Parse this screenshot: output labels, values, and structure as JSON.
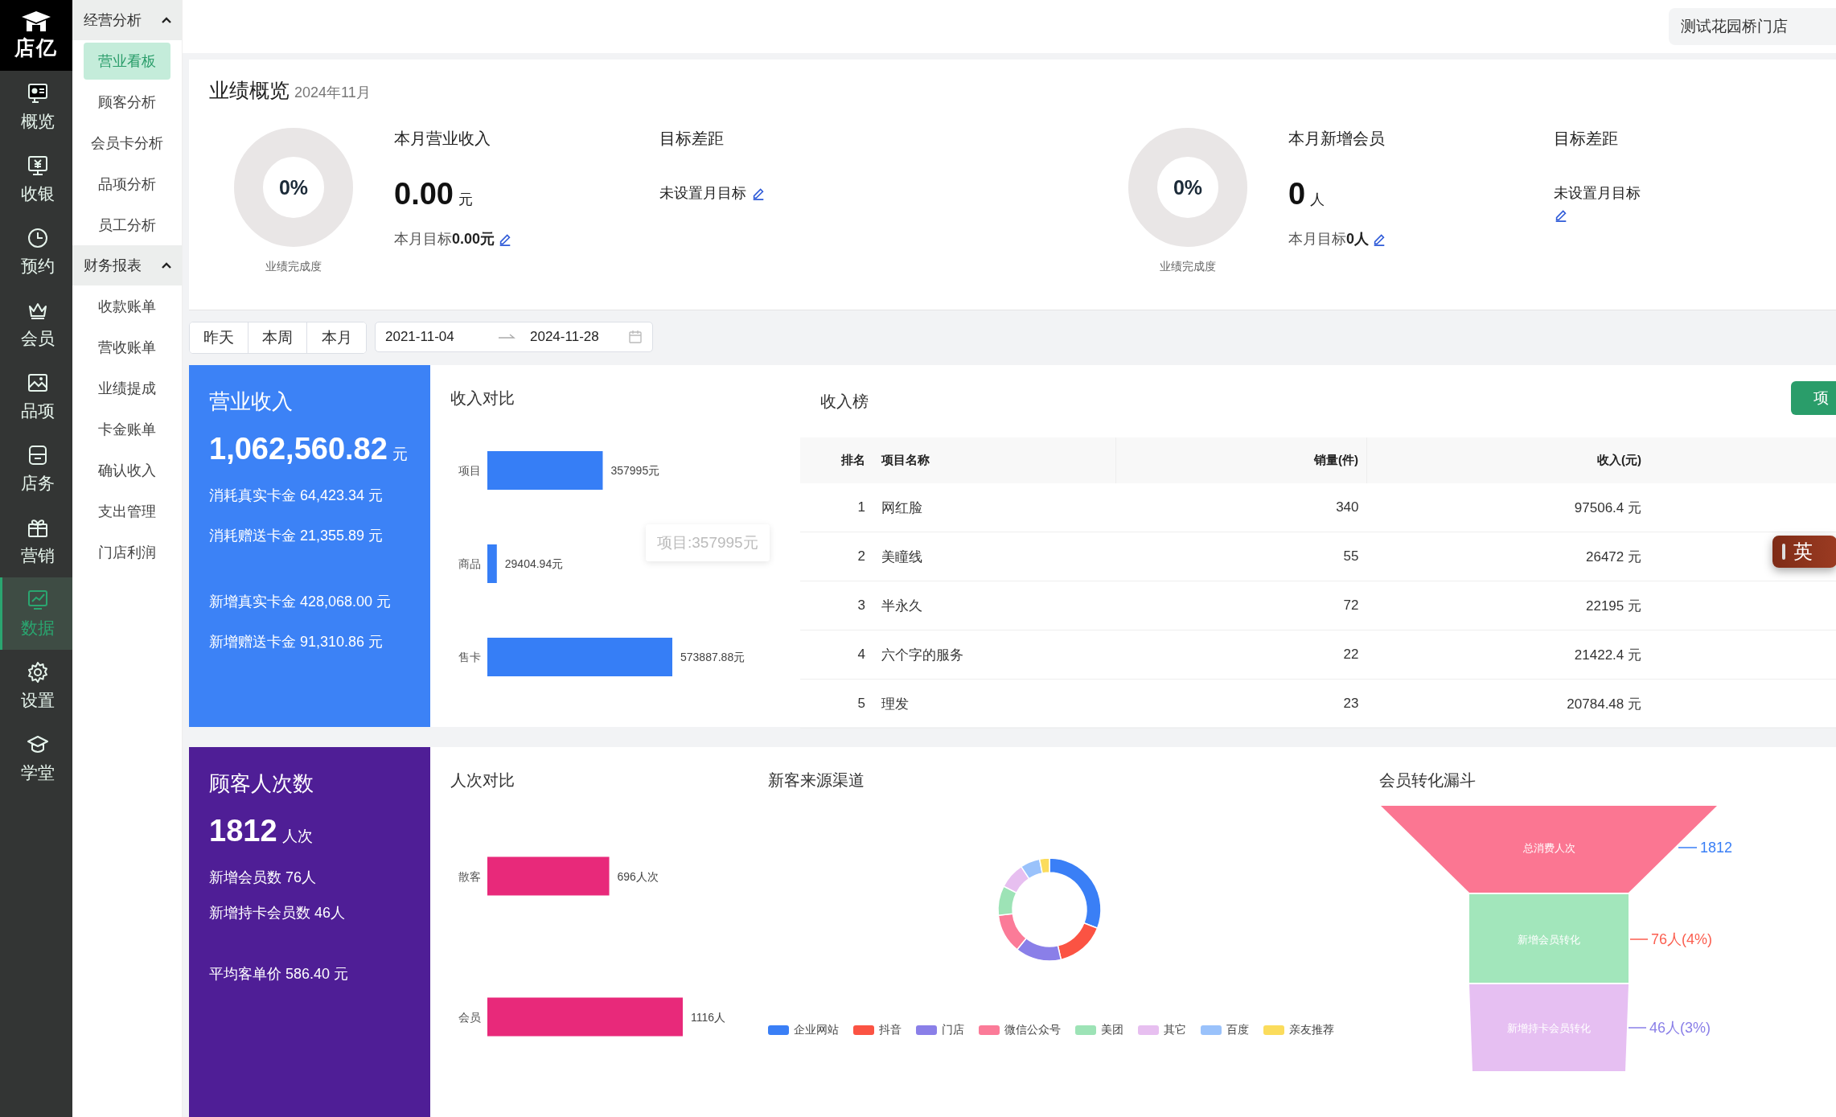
{
  "sidebar": {
    "logo": "店亿",
    "items": [
      {
        "label": "概览",
        "selected": false
      },
      {
        "label": "收银",
        "selected": false
      },
      {
        "label": "预约",
        "selected": false
      },
      {
        "label": "会员",
        "selected": false
      },
      {
        "label": "品项",
        "selected": false
      },
      {
        "label": "店务",
        "selected": false
      },
      {
        "label": "营销",
        "selected": false
      },
      {
        "label": "数据",
        "selected": true
      },
      {
        "label": "设置",
        "selected": false
      },
      {
        "label": "学堂",
        "selected": false
      }
    ]
  },
  "submenu": [
    {
      "title": "经营分析",
      "expanded": true,
      "items": [
        {
          "label": "营业看板",
          "selected": true
        },
        {
          "label": "顾客分析",
          "selected": false
        },
        {
          "label": "会员卡分析",
          "selected": false
        },
        {
          "label": "品项分析",
          "selected": false
        },
        {
          "label": "员工分析",
          "selected": false
        }
      ]
    },
    {
      "title": "财务报表",
      "expanded": true,
      "items": [
        {
          "label": "收款账单",
          "selected": false
        },
        {
          "label": "营收账单",
          "selected": false
        },
        {
          "label": "业绩提成",
          "selected": false
        },
        {
          "label": "卡金账单",
          "selected": false
        },
        {
          "label": "确认收入",
          "selected": false
        },
        {
          "label": "支出管理",
          "selected": false
        },
        {
          "label": "门店利润",
          "selected": false
        }
      ]
    }
  ],
  "header": {
    "store": "测试花园桥门店"
  },
  "overview": {
    "title": "业绩概览",
    "period": "2024年11月",
    "blocks": [
      {
        "gauge": "0%",
        "level": 0,
        "gauge_label": "业绩完成度",
        "metric_label": "本月营业收入",
        "value": "0.00",
        "unit": "元",
        "target_prefix": "本月目标",
        "target_value": "0.00元",
        "gap_label": "目标差距",
        "gap_text": "未设置月目标"
      },
      {
        "gauge": "0%",
        "level": 0,
        "gauge_label": "业绩完成度",
        "metric_label": "本月新增会员",
        "value": "0",
        "unit": "人",
        "target_prefix": "本月目标",
        "target_value": "0人",
        "gap_label": "目标差距",
        "gap_text": "未设置月目标"
      }
    ]
  },
  "filters": {
    "quick": [
      {
        "label": "昨天",
        "selected": false
      },
      {
        "label": "本周",
        "selected": false
      },
      {
        "label": "本月",
        "selected": false
      }
    ],
    "start": "2021-11-04",
    "end": "2024-11-28"
  },
  "revenue": {
    "panel": {
      "title": "营业收入",
      "value": "1,062,560.82",
      "unit": "元",
      "line_groups": [
        [
          "消耗真实卡金 64,423.34 元",
          "消耗赠送卡金 21,355.89 元"
        ],
        [
          "新增真实卡金 428,068.00 元",
          "新增赠送卡金 91,310.86 元"
        ]
      ]
    },
    "comparison": {
      "title": "收入对比",
      "tooltip": "项目:357995元",
      "chart_data": {
        "type": "bar",
        "orientation": "horizontal",
        "categories": [
          "项目",
          "商品",
          "售卡"
        ],
        "values": [
          357995,
          29404.94,
          573887.88
        ],
        "value_labels": [
          "357995元",
          "29404.94元",
          "573887.88元"
        ]
      }
    },
    "ranking": {
      "title": "收入榜",
      "tab_button": "项",
      "columns": [
        "排名",
        "项目名称",
        "销量(件)",
        "收入(元)"
      ],
      "rows": [
        [
          "1",
          "网红脸",
          "340",
          "97506.4 元"
        ],
        [
          "2",
          "美瞳线",
          "55",
          "26472 元"
        ],
        [
          "3",
          "半永久",
          "72",
          "22195 元"
        ],
        [
          "4",
          "六个字的服务",
          "22",
          "21422.4 元"
        ],
        [
          "5",
          "理发",
          "23",
          "20784.48 元"
        ]
      ]
    }
  },
  "ime_indicator": {
    "label": "英"
  },
  "customers": {
    "panel": {
      "title": "顾客人次数",
      "value": "1812",
      "unit": "人次",
      "line_groups": [
        [
          "新增会员数 76人",
          "新增持卡会员数 46人"
        ],
        [
          "平均客单价 586.40 元"
        ]
      ]
    },
    "comparison": {
      "title": "人次对比",
      "chart_data": {
        "type": "bar",
        "orientation": "horizontal",
        "categories": [
          "散客",
          "会员"
        ],
        "values": [
          696,
          1116
        ],
        "value_labels": [
          "696人次",
          "1116人"
        ]
      }
    },
    "sources": {
      "title": "新客来源渠道",
      "legend": [
        {
          "label": "企业网站",
          "color": "#3a7ff6"
        },
        {
          "label": "抖音",
          "color": "#fb5343"
        },
        {
          "label": "门店",
          "color": "#8a7fe8"
        },
        {
          "label": "微信公众号",
          "color": "#fb7b98"
        },
        {
          "label": "美团",
          "color": "#9de3b6"
        },
        {
          "label": "其它",
          "color": "#e7bff0"
        },
        {
          "label": "百度",
          "color": "#9ac2fb"
        },
        {
          "label": "亲友推荐",
          "color": "#fbdc5c"
        }
      ]
    },
    "funnel": {
      "title": "会员转化漏斗",
      "stages": [
        {
          "label": "总消费人次",
          "value": "1812",
          "color": "#fb7692"
        },
        {
          "label": "新增会员转化",
          "value": "76人(4%)",
          "color": "#a2e6bb"
        },
        {
          "label": "新增持卡会员转化",
          "value": "46人(3%)",
          "color": "#e6bff2"
        }
      ]
    }
  }
}
